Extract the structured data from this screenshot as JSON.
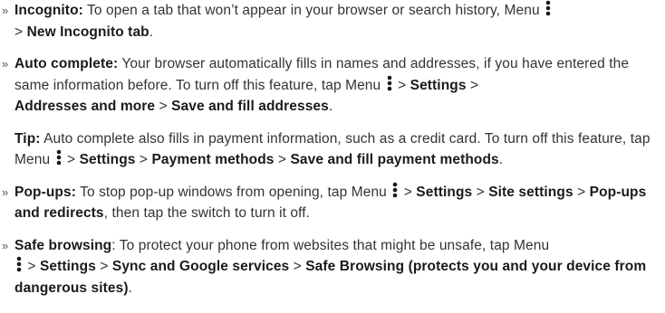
{
  "bullet": "»",
  "icons": {
    "menu": "vertical-three-dots-icon"
  },
  "incognito": {
    "term": "Incognito:",
    "text1": " To open a tab that won’t appear in your browser or search history, Menu ",
    "text2": " > ",
    "target": "New Incognito tab",
    "text3": "."
  },
  "autocomplete": {
    "term": "Auto complete:",
    "text1": " Your browser automatically fills in names and addresses, if you have entered the same information before. To turn off this feature, tap Menu ",
    "text2": " > ",
    "settings": "Settings",
    "text3": " > ",
    "addresses": "Addresses and more",
    "text4": " > ",
    "save": "Save and fill addresses",
    "text5": "."
  },
  "tip": {
    "term": "Tip:",
    "text1": " Auto complete also fills in payment information, such as a credit card. To turn off this feature, tap Menu ",
    "text2": " > ",
    "settings": "Settings",
    "text3": " > ",
    "payment": "Payment methods",
    "text4": " > ",
    "save": "Save and fill payment methods",
    "text5": "."
  },
  "popups": {
    "term": "Pop-ups:",
    "text1": " To stop pop-up windows from opening, tap Menu ",
    "text2": " > ",
    "settings": "Settings",
    "text3": " > ",
    "site": "Site settings",
    "text4": " > ",
    "redirects": "Pop-ups and redirects",
    "text5": ", then tap the switch to turn it off."
  },
  "safe": {
    "term": "Safe browsing",
    "text1": ": To protect your phone from websites that might be unsafe, tap Menu ",
    "text2": " > ",
    "settings": "Settings",
    "text3": " > ",
    "sync": "Sync and Google services",
    "text4": " > ",
    "browsing": "Safe Browsing (protects you and your device from dangerous sites)",
    "text5": "."
  }
}
